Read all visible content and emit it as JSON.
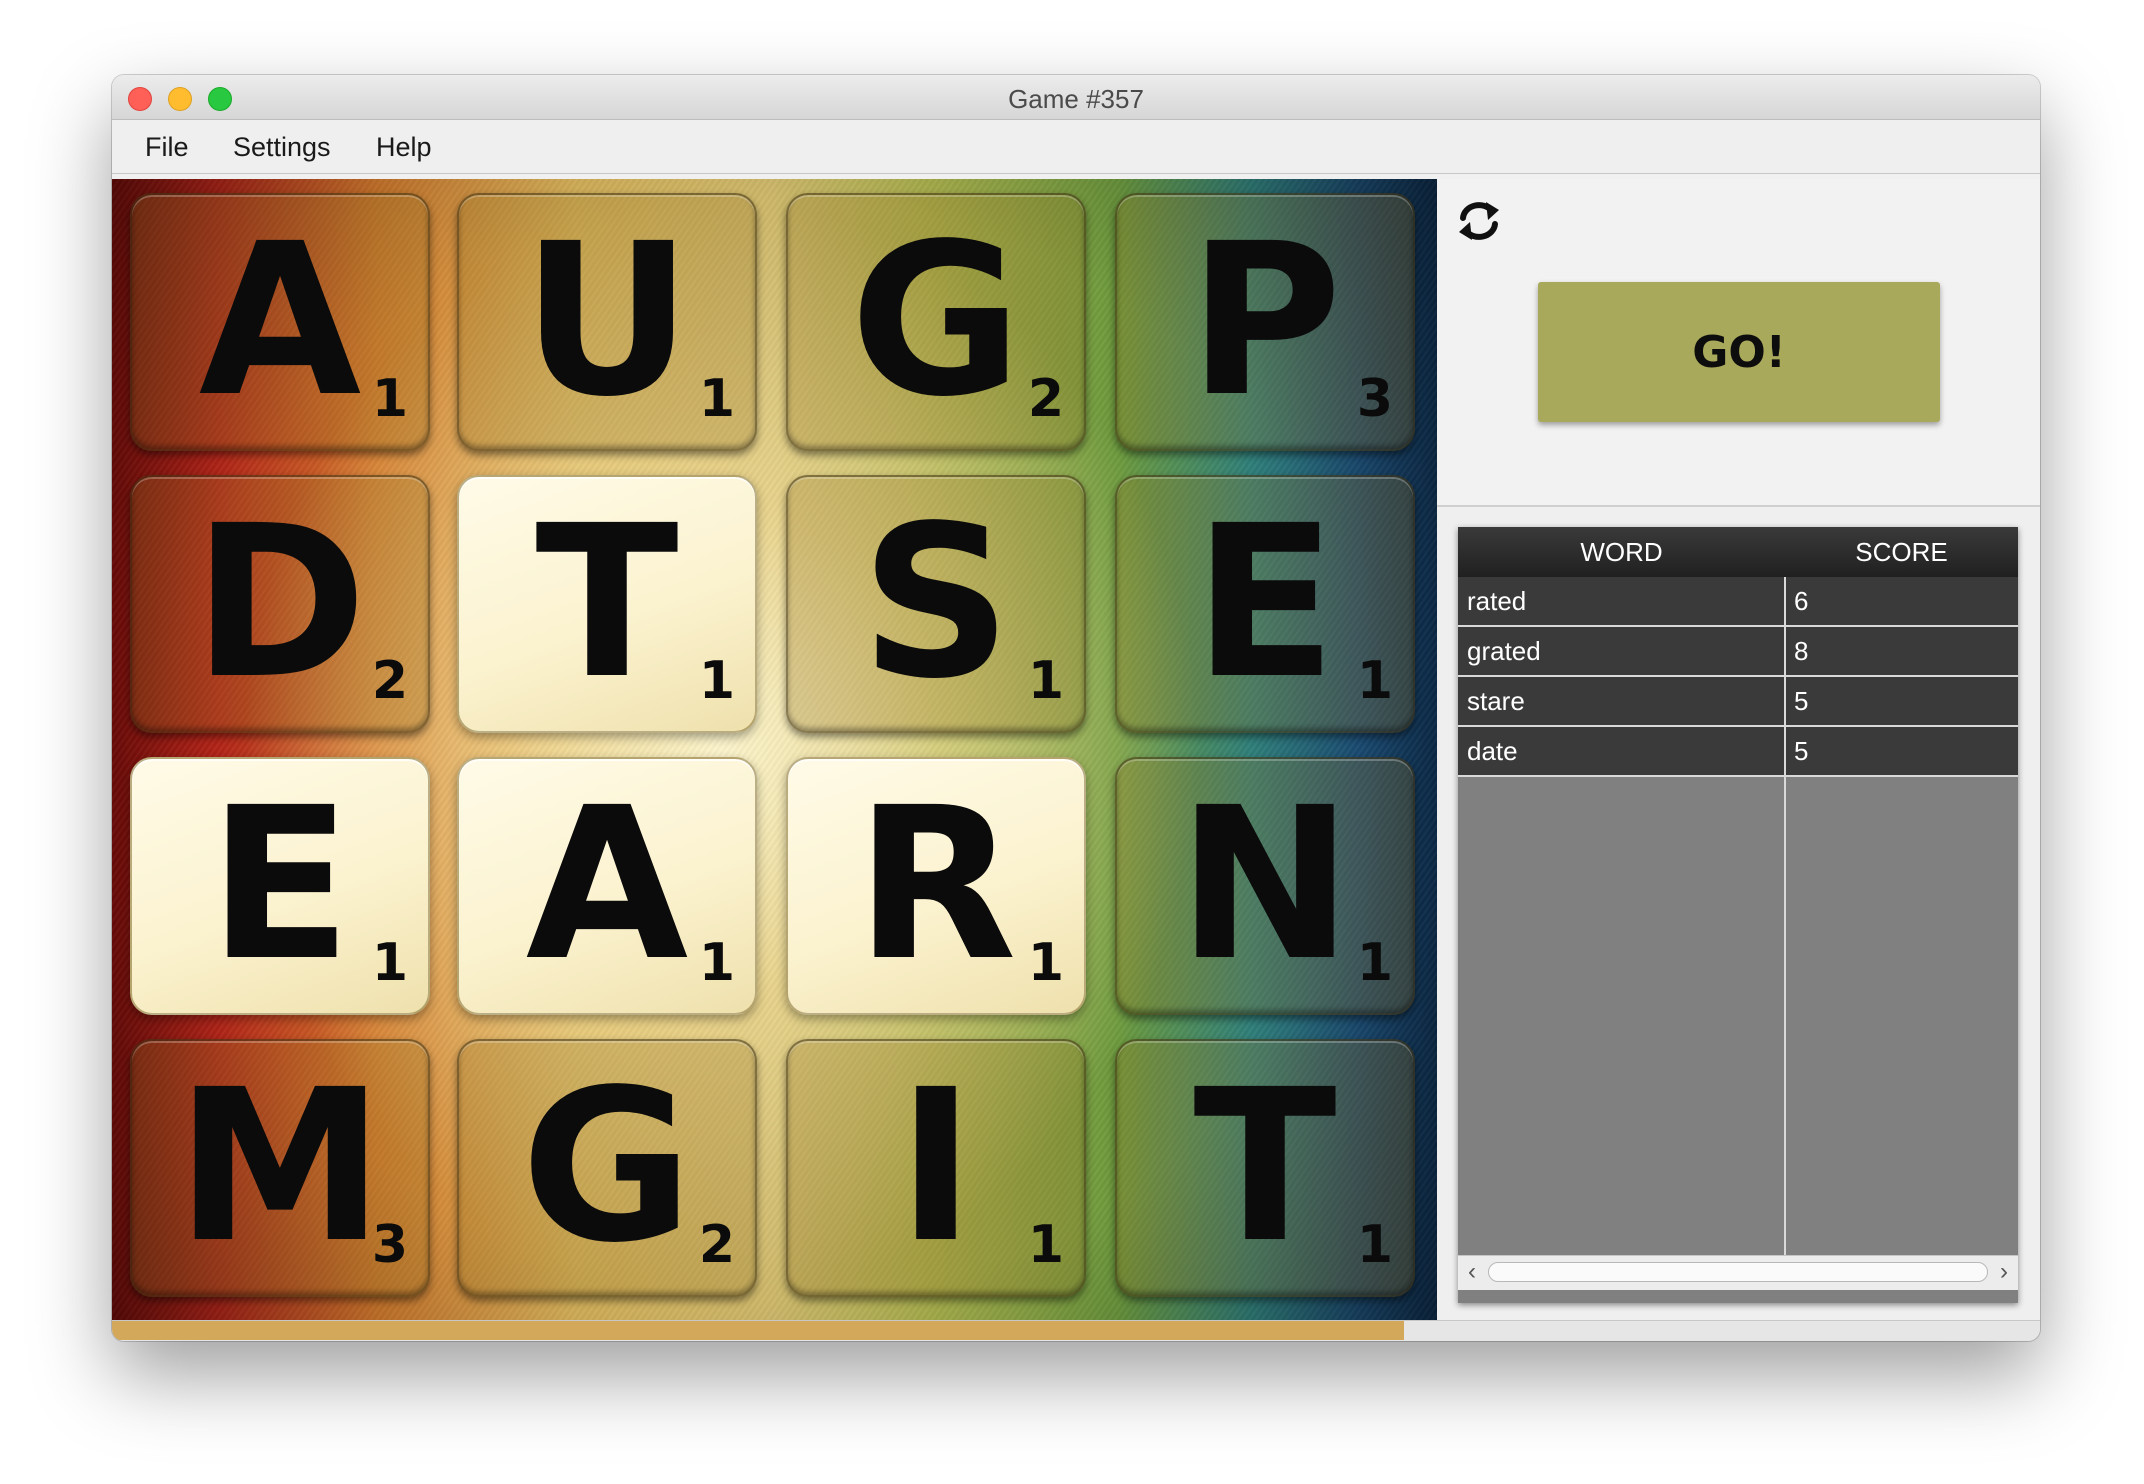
{
  "window": {
    "title": "Game #357"
  },
  "menu": {
    "items": [
      "File",
      "Settings",
      "Help"
    ]
  },
  "board": {
    "tiles": [
      {
        "letter": "A",
        "points": "1",
        "highlighted": false
      },
      {
        "letter": "U",
        "points": "1",
        "highlighted": false
      },
      {
        "letter": "G",
        "points": "2",
        "highlighted": false
      },
      {
        "letter": "P",
        "points": "3",
        "highlighted": false
      },
      {
        "letter": "D",
        "points": "2",
        "highlighted": false
      },
      {
        "letter": "T",
        "points": "1",
        "highlighted": true
      },
      {
        "letter": "S",
        "points": "1",
        "highlighted": false
      },
      {
        "letter": "E",
        "points": "1",
        "highlighted": false
      },
      {
        "letter": "E",
        "points": "1",
        "highlighted": true
      },
      {
        "letter": "A",
        "points": "1",
        "highlighted": true
      },
      {
        "letter": "R",
        "points": "1",
        "highlighted": true
      },
      {
        "letter": "N",
        "points": "1",
        "highlighted": false
      },
      {
        "letter": "M",
        "points": "3",
        "highlighted": false
      },
      {
        "letter": "G",
        "points": "2",
        "highlighted": false
      },
      {
        "letter": "I",
        "points": "1",
        "highlighted": false
      },
      {
        "letter": "T",
        "points": "1",
        "highlighted": false
      }
    ]
  },
  "controls": {
    "refresh_icon": "refresh-icon",
    "go_label": "GO!"
  },
  "words_table": {
    "headers": [
      "WORD",
      "SCORE"
    ],
    "rows": [
      {
        "word": "rated",
        "score": "6"
      },
      {
        "word": "grated",
        "score": "8"
      },
      {
        "word": "stare",
        "score": "5"
      },
      {
        "word": "date",
        "score": "5"
      }
    ],
    "scroll_left_icon": "chevron-left-icon",
    "scroll_right_icon": "chevron-right-icon"
  },
  "timer": {
    "progress_fraction": 0.67
  },
  "colors": {
    "go_button": "#a9a95b",
    "progress_fill": "#d4a85a",
    "table_row": "#3a3a3a",
    "table_empty": "#808080"
  }
}
